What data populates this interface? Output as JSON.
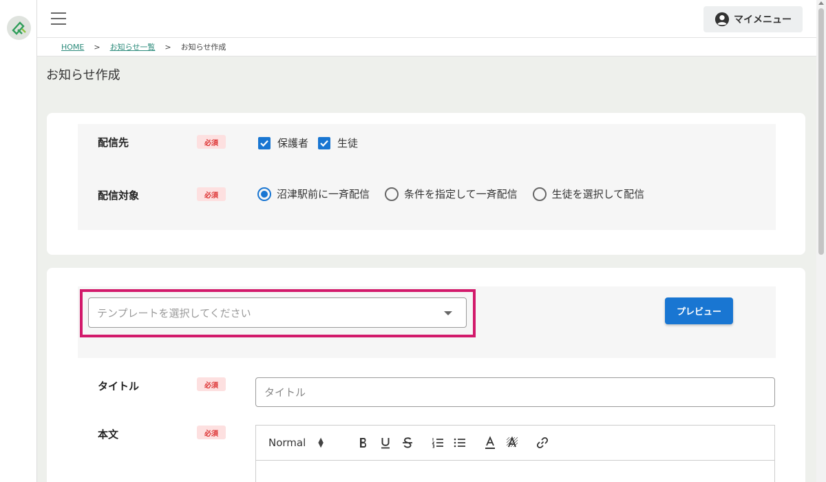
{
  "header": {
    "my_menu_label": "マイメニュー"
  },
  "breadcrumb": {
    "home": "HOME",
    "separator": ">",
    "list": "お知らせ一覧",
    "current": "お知らせ作成"
  },
  "page": {
    "title": "お知らせ作成"
  },
  "destination": {
    "label": "配信先",
    "required": "必須",
    "options": [
      {
        "label": "保護者",
        "checked": true
      },
      {
        "label": "生徒",
        "checked": true
      }
    ]
  },
  "target": {
    "label": "配信対象",
    "required": "必須",
    "options": [
      {
        "label": "沼津駅前に一斉配信",
        "selected": true
      },
      {
        "label": "条件を指定して一斉配信",
        "selected": false
      },
      {
        "label": "生徒を選択して配信",
        "selected": false
      }
    ]
  },
  "template": {
    "placeholder": "テンプレートを選択してください"
  },
  "preview_button": "プレビュー",
  "title_field": {
    "label": "タイトル",
    "required": "必須",
    "placeholder": "タイトル"
  },
  "body_field": {
    "label": "本文",
    "required": "必須",
    "format": "Normal"
  },
  "colors": {
    "accent": "#1976d2",
    "highlight": "#d21a6b",
    "required_bg": "#fde0e0",
    "required_text": "#dd3333"
  }
}
